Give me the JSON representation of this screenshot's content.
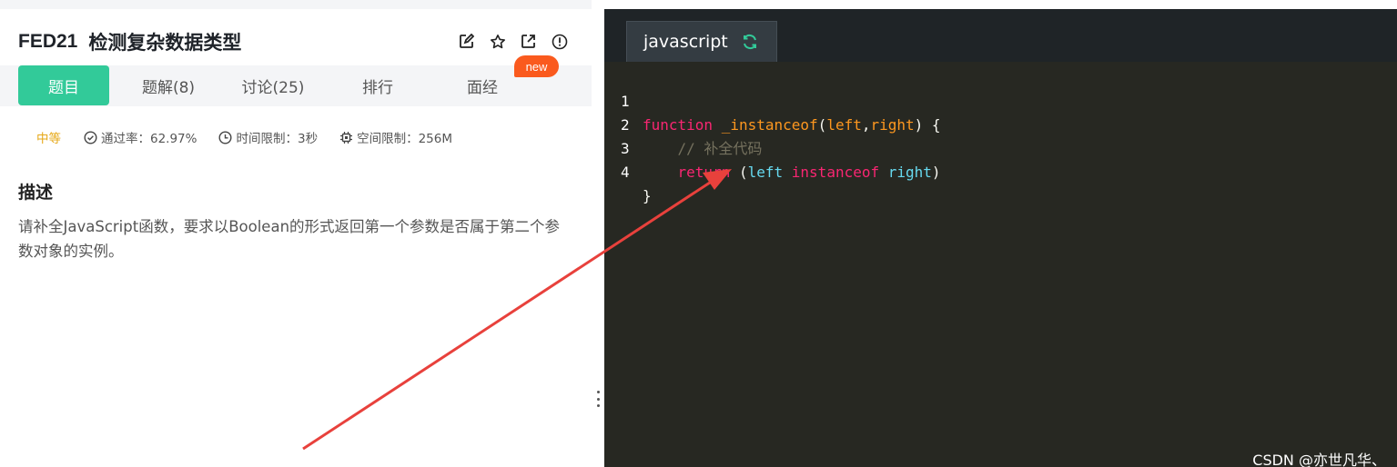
{
  "problem": {
    "code": "FED21",
    "title": "检测复杂数据类型",
    "tools": [
      "edit-icon",
      "star-icon",
      "open-external-icon",
      "info-icon"
    ]
  },
  "tabs": [
    {
      "label": "题目",
      "active": true
    },
    {
      "label": "题解(8)",
      "active": false
    },
    {
      "label": "讨论(25)",
      "active": false
    },
    {
      "label": "排行",
      "active": false
    },
    {
      "label": "面经",
      "active": false
    }
  ],
  "new_badge": "new",
  "meta": {
    "difficulty": "中等",
    "pass_rate": "通过率：62.97%",
    "time_limit": "时间限制：3秒",
    "space_limit": "空间限制：256M"
  },
  "description": {
    "heading": "描述",
    "text": "请补全JavaScript函数，要求以Boolean的形式返回第一个参数是否属于第二个参数对象的实例。"
  },
  "editor": {
    "language": "javascript",
    "line_numbers": [
      "1",
      "2",
      "3",
      "4"
    ],
    "code": {
      "l1_kw": "function",
      "l1_name": "_instanceof",
      "l1_open": "(",
      "l1_p1": "left",
      "l1_comma": ",",
      "l1_p2": "right",
      "l1_close": ") {",
      "l2_comment": "// 补全代码",
      "l3_kw": "return",
      "l3_open": "(",
      "l3_left": "left",
      "l3_op": "instanceof",
      "l3_right": "right",
      "l3_close": ")",
      "l4_brace": "}"
    }
  },
  "watermark": "CSDN @亦世凡华、",
  "colors": {
    "accent_green": "#32ca99",
    "badge_orange": "#fa5a1e",
    "difficulty_yellow": "#e6a817",
    "editor_bg": "#272822",
    "annotation_arrow": "#e8413c"
  }
}
